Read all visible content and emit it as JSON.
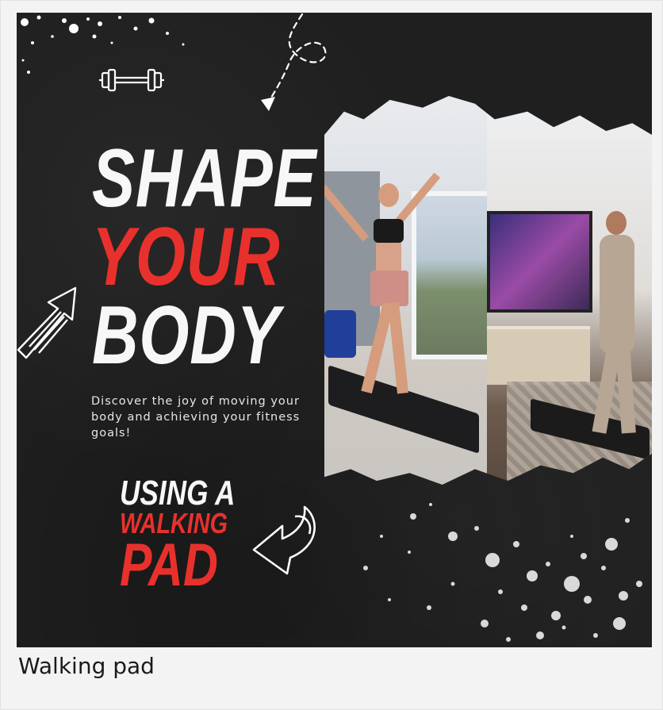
{
  "poster": {
    "headline": [
      "SHAPE",
      "YOUR",
      "BODY"
    ],
    "tagline": "Discover the joy of moving your body and achieving your fitness goals!",
    "cta": [
      "USING A",
      "WALKING",
      "PAD"
    ],
    "icons": [
      "dumbbell-icon",
      "dashed-arrow-icon",
      "arrow-icon",
      "arrow-left-icon"
    ],
    "colors": {
      "background": "#1f1f1f",
      "accent": "#e8312c",
      "text": "#f7f7f7"
    }
  },
  "caption": "Walking pad"
}
